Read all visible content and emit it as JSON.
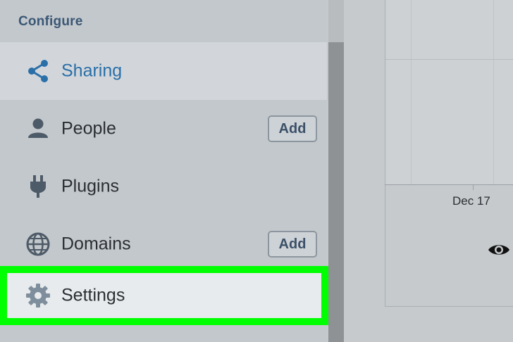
{
  "sidebar": {
    "section_title": "Configure",
    "items": [
      {
        "label": "Sharing",
        "icon": "share-icon",
        "active": true
      },
      {
        "label": "People",
        "icon": "person-icon",
        "action": "Add"
      },
      {
        "label": "Plugins",
        "icon": "plug-icon"
      },
      {
        "label": "Domains",
        "icon": "globe-icon",
        "action": "Add"
      },
      {
        "label": "Settings",
        "icon": "gear-icon",
        "highlighted": true
      }
    ]
  },
  "chart": {
    "x_tick_label": "Dec 17",
    "icon": "eye-icon"
  },
  "colors": {
    "highlight": "#00ff00",
    "active_text": "#2a6fa8",
    "sidebar_bg": "#c3c8cc"
  }
}
